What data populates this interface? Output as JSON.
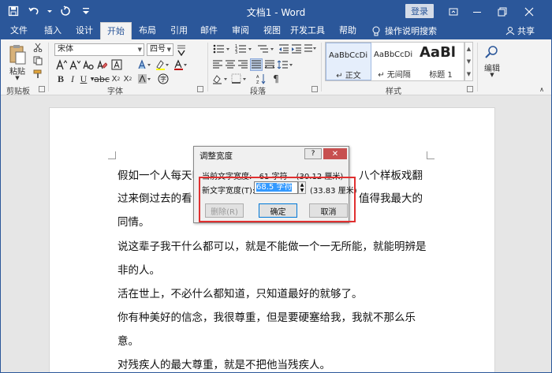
{
  "title_bar": {
    "doc_title": "文档1 - Word",
    "login": "登录"
  },
  "tabs": [
    {
      "label": "文件"
    },
    {
      "label": "插入"
    },
    {
      "label": "设计"
    },
    {
      "label": "开始"
    },
    {
      "label": "布局"
    },
    {
      "label": "引用"
    },
    {
      "label": "邮件"
    },
    {
      "label": "审阅"
    },
    {
      "label": "视图"
    },
    {
      "label": "开发工具"
    },
    {
      "label": "帮助"
    }
  ],
  "active_tab": "开始",
  "tell_me": "操作说明搜索",
  "share": "共享",
  "ribbon": {
    "clipboard": {
      "paste": "粘贴",
      "label": "剪贴板"
    },
    "font": {
      "name": "宋体",
      "size": "四号",
      "label": "字体"
    },
    "paragraph": {
      "label": "段落"
    },
    "styles": {
      "label": "样式",
      "items": [
        {
          "sample": "AaBbCcDi",
          "name": "↵ 正文"
        },
        {
          "sample": "AaBbCcDi",
          "name": "↵ 无间隔"
        },
        {
          "sample": "AaBl",
          "name": "标题 1"
        }
      ]
    },
    "editing": {
      "label": "编辑"
    }
  },
  "document": {
    "lines": [
      "假如一个人每天叫",
      "八个样板戏翻",
      "过来倒过去的看，",
      "值得我最大的",
      "同情。",
      "说这辈子我干什么都可以，就是不能做一个一无所能，就能明辨是",
      "非的人。",
      "活在世上，不必什么都知道，只知道最好的就够了。",
      "你有种美好的信念，我很尊重，但是要硬塞给我，我就不那么乐",
      "意。",
      "对残疾人的最大尊重，就是不把他当残疾人。"
    ]
  },
  "dialog": {
    "title": "调整宽度",
    "help": "?",
    "close": "✕",
    "current_label": "当前文字宽度:",
    "current_chars": "61 字符",
    "current_cm": "(30.12 厘米)",
    "new_label": "新文字宽度(T):",
    "new_value": "68.5 字符",
    "new_cm": "(33.83 厘米)",
    "delete_btn": "删除(R)",
    "ok_btn": "确定",
    "cancel_btn": "取消"
  },
  "colors": {
    "brand": "#2b579a",
    "highlight": "#e03030",
    "selection": "#3399ff"
  }
}
